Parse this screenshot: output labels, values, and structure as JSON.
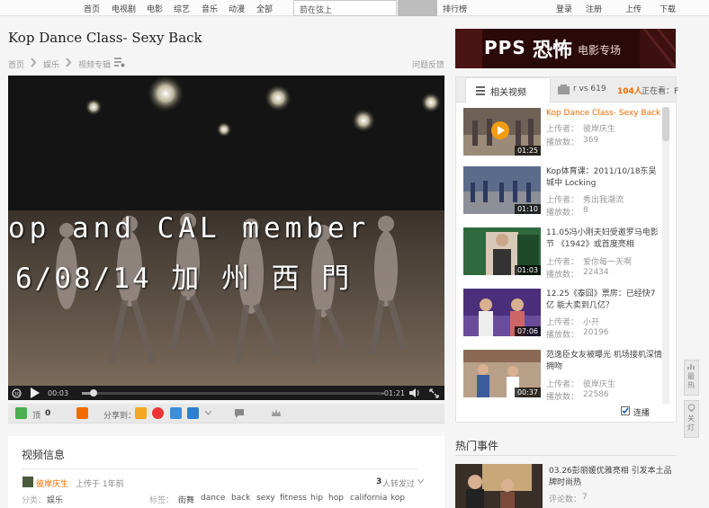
{
  "topnav": {
    "items": [
      "首页",
      "电视剧",
      "电影",
      "综艺",
      "音乐",
      "动漫",
      "全部"
    ],
    "search_placeholder": "箭在弦上",
    "ranking": "排行榜",
    "login": "登录",
    "register": "注册",
    "upload": "上传",
    "download": "下载"
  },
  "video": {
    "title": "Kop Dance Class- Sexy Back",
    "breadcrumb": [
      "首页",
      "娱乐",
      "视频专辑"
    ],
    "feedback": "问题反馈",
    "overlay_line1": "op and CAL member",
    "overlay_line2": "6/08/14 加 州 西 門",
    "current_time": "00:03",
    "remaining_time": "-01:21",
    "progress": 0.04
  },
  "actions": {
    "top_label": "顶",
    "top_count": "0",
    "share_label": "分享到："
  },
  "info": {
    "section_title": "视频信息",
    "uploader": "彼岸庆生",
    "upload_time": "上传于 1年前",
    "reposts_count": "3",
    "reposts_label": "人转发过",
    "category_label": "分类：",
    "category": "娱乐",
    "tags_label": "标签：",
    "tags": [
      "街舞",
      "dance",
      "back",
      "sexy",
      "fitness",
      "hip",
      "hop",
      "california",
      "kop"
    ]
  },
  "banner": {
    "text_pps": "PPS",
    "text_main": "恐怖",
    "text_sub": "电影专场"
  },
  "related": {
    "tab_label": "相关视频",
    "ticker_vs": "r vs 619",
    "ticker_count": "104人",
    "ticker_tail": "正在看：F",
    "autoplay_label": "连播",
    "uploader_prefix": "上传者：",
    "plays_prefix": "播放数：",
    "items": [
      {
        "title": "Kop Dance Class- Sexy Back",
        "uploader": "彼岸庆生",
        "plays": "369",
        "duration": "01:25"
      },
      {
        "title": "Kop体育课：2011/10/18东吴城中 Locking",
        "uploader": "秀出我潮流",
        "plays": "8",
        "duration": "01:10"
      },
      {
        "title": "11.05冯小刚夫妇受邀罗马电影节 《1942》或首度亮相",
        "uploader": "爱你每一天啊",
        "plays": "22434",
        "duration": "01:03"
      },
      {
        "title": "12.25《泰囧》票房：已经快7亿 能大卖到几亿？",
        "uploader": "小开",
        "plays": "20196",
        "duration": "07:06"
      },
      {
        "title": "范逸臣女友被曝光 机场接机深情拥吻",
        "uploader": "彼岸庆生",
        "plays": "22586",
        "duration": "00:37"
      }
    ]
  },
  "hot": {
    "section_title": "热门事件",
    "item_title": "03.26彭丽媛优雅亮相 引发本土品牌时尚热",
    "comments_prefix": "评论数：",
    "comments": "7"
  },
  "side": {
    "rank_label": "最热",
    "light_label": "关灯"
  },
  "colors": {
    "accent": "#f26a00",
    "ticker_count": "#f26a00",
    "tag": "#555555"
  }
}
